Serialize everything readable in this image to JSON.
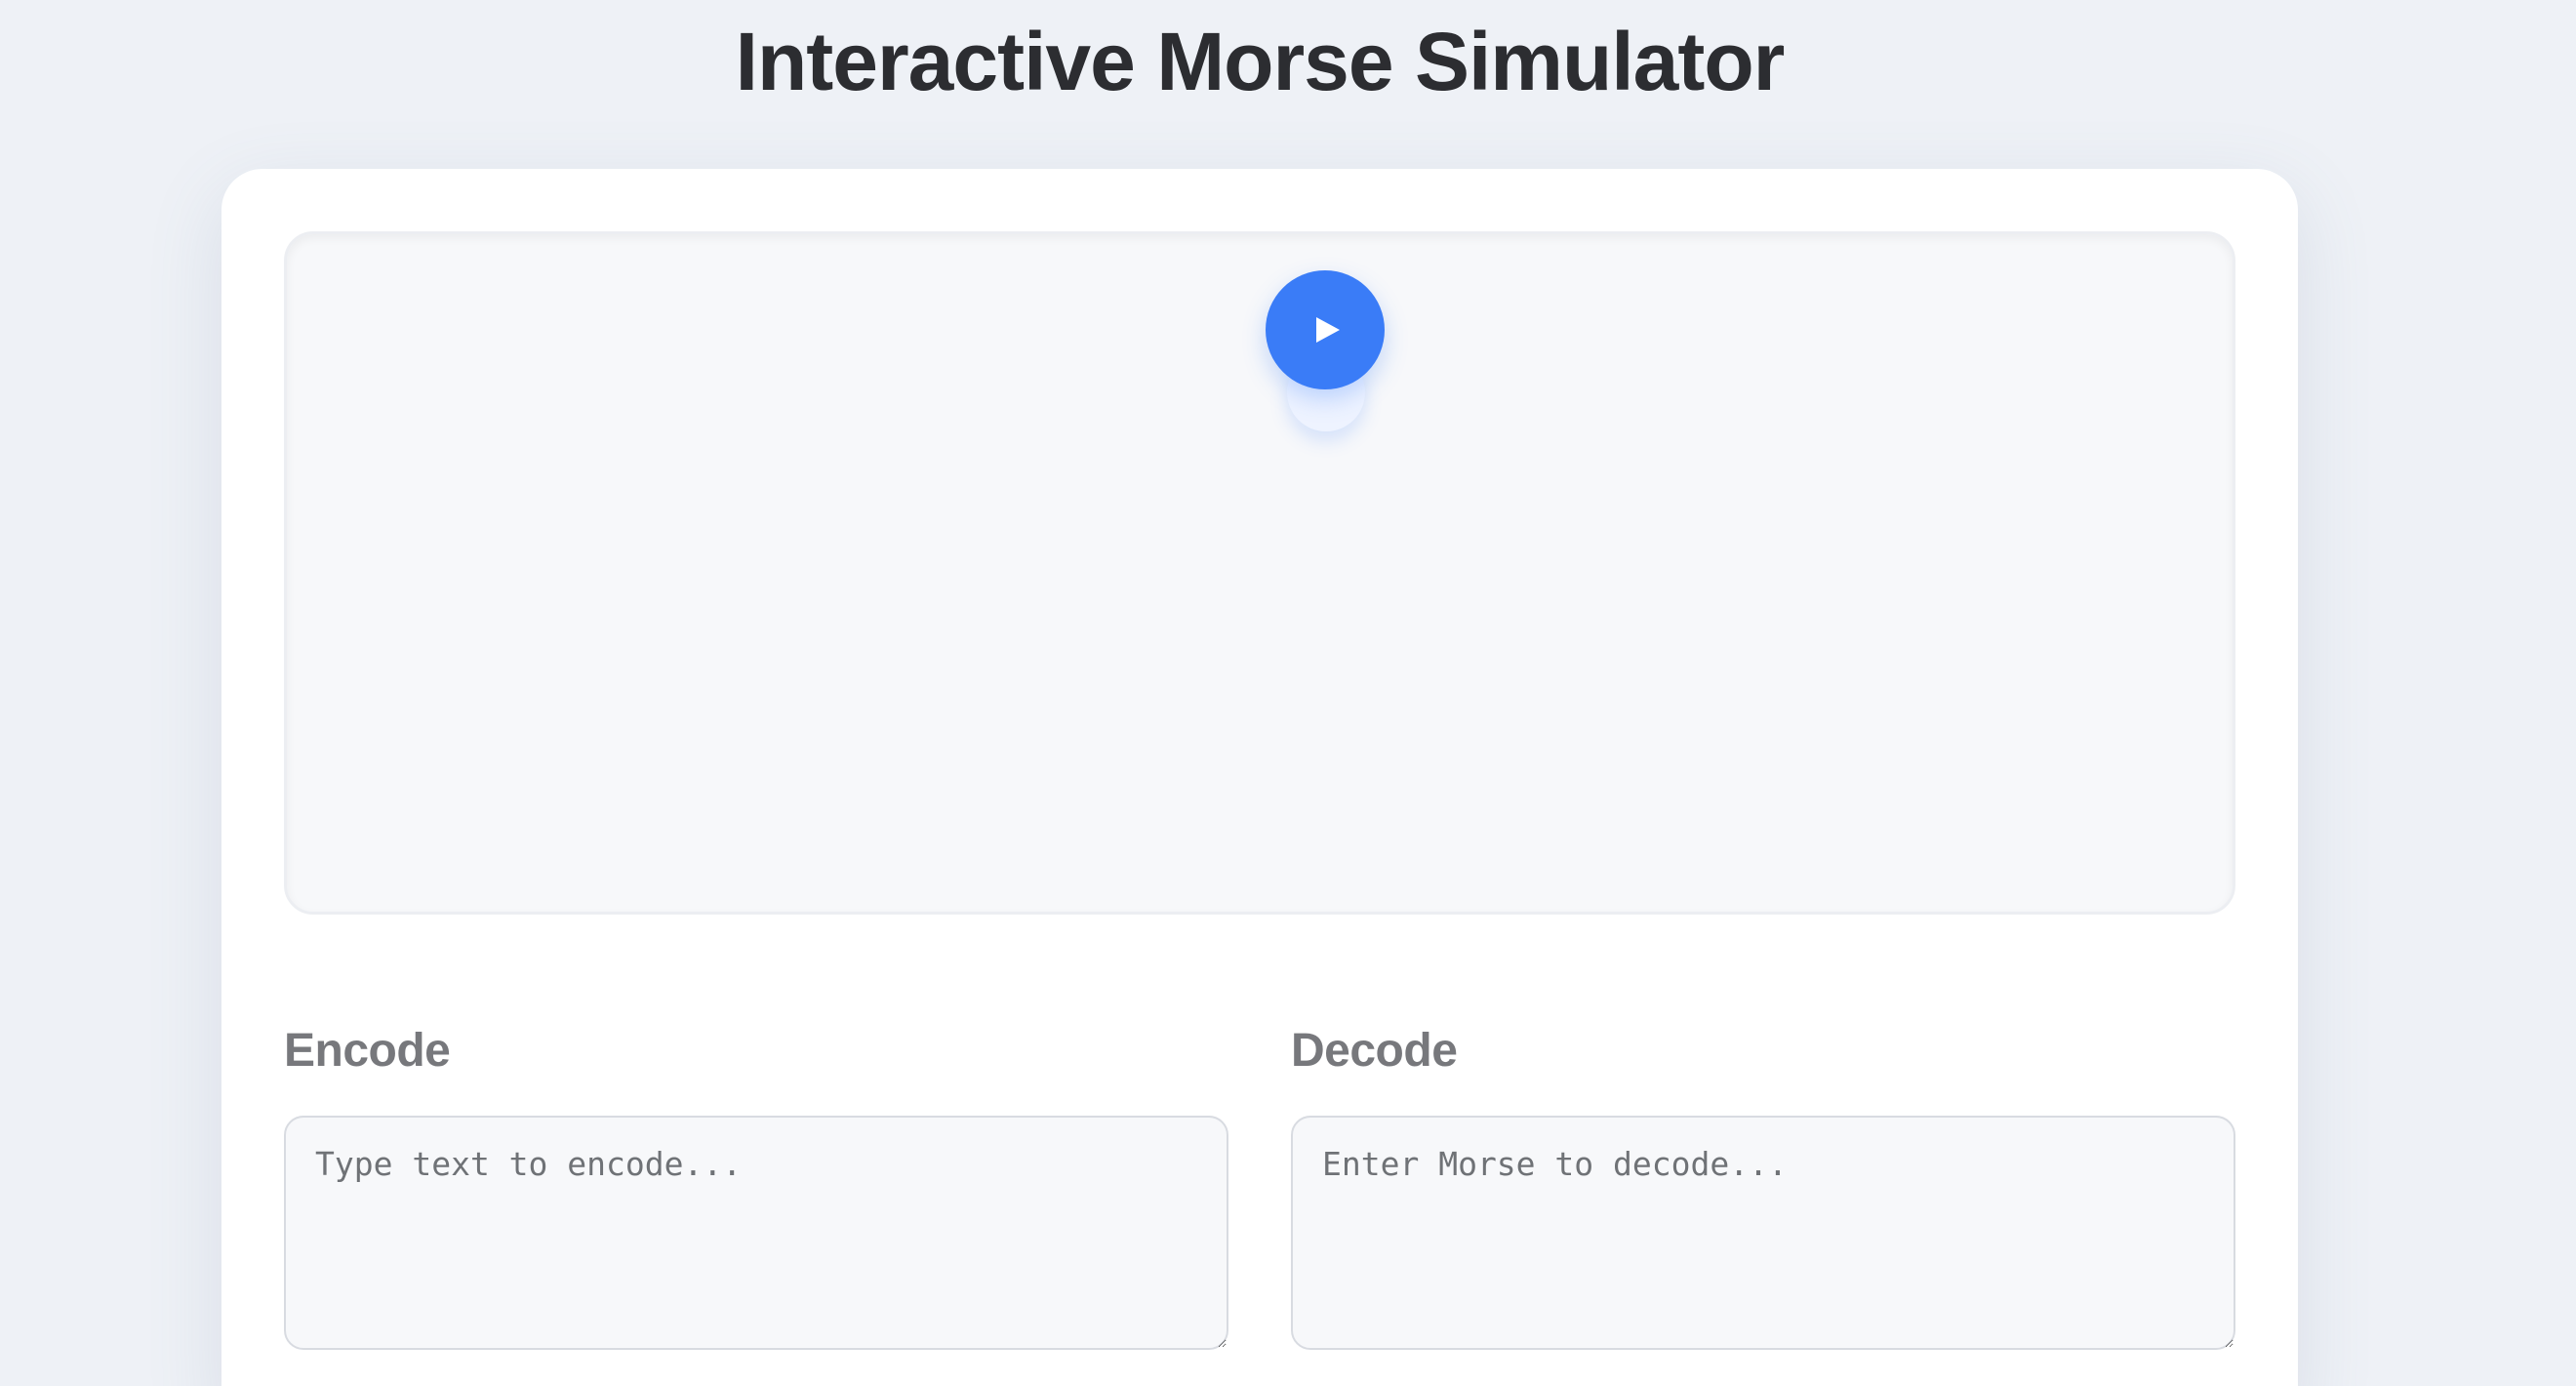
{
  "page": {
    "title": "Interactive Morse Simulator"
  },
  "player": {
    "play_icon": "play-icon"
  },
  "encode": {
    "label": "Encode",
    "value": "",
    "placeholder": "Type text to encode..."
  },
  "decode": {
    "label": "Decode",
    "value": "",
    "placeholder": "Enter Morse to decode..."
  },
  "colors": {
    "background": "#eef1f6",
    "card": "#ffffff",
    "accent": "#3a7cf7",
    "title": "#2c2d31",
    "label": "#77787c"
  }
}
